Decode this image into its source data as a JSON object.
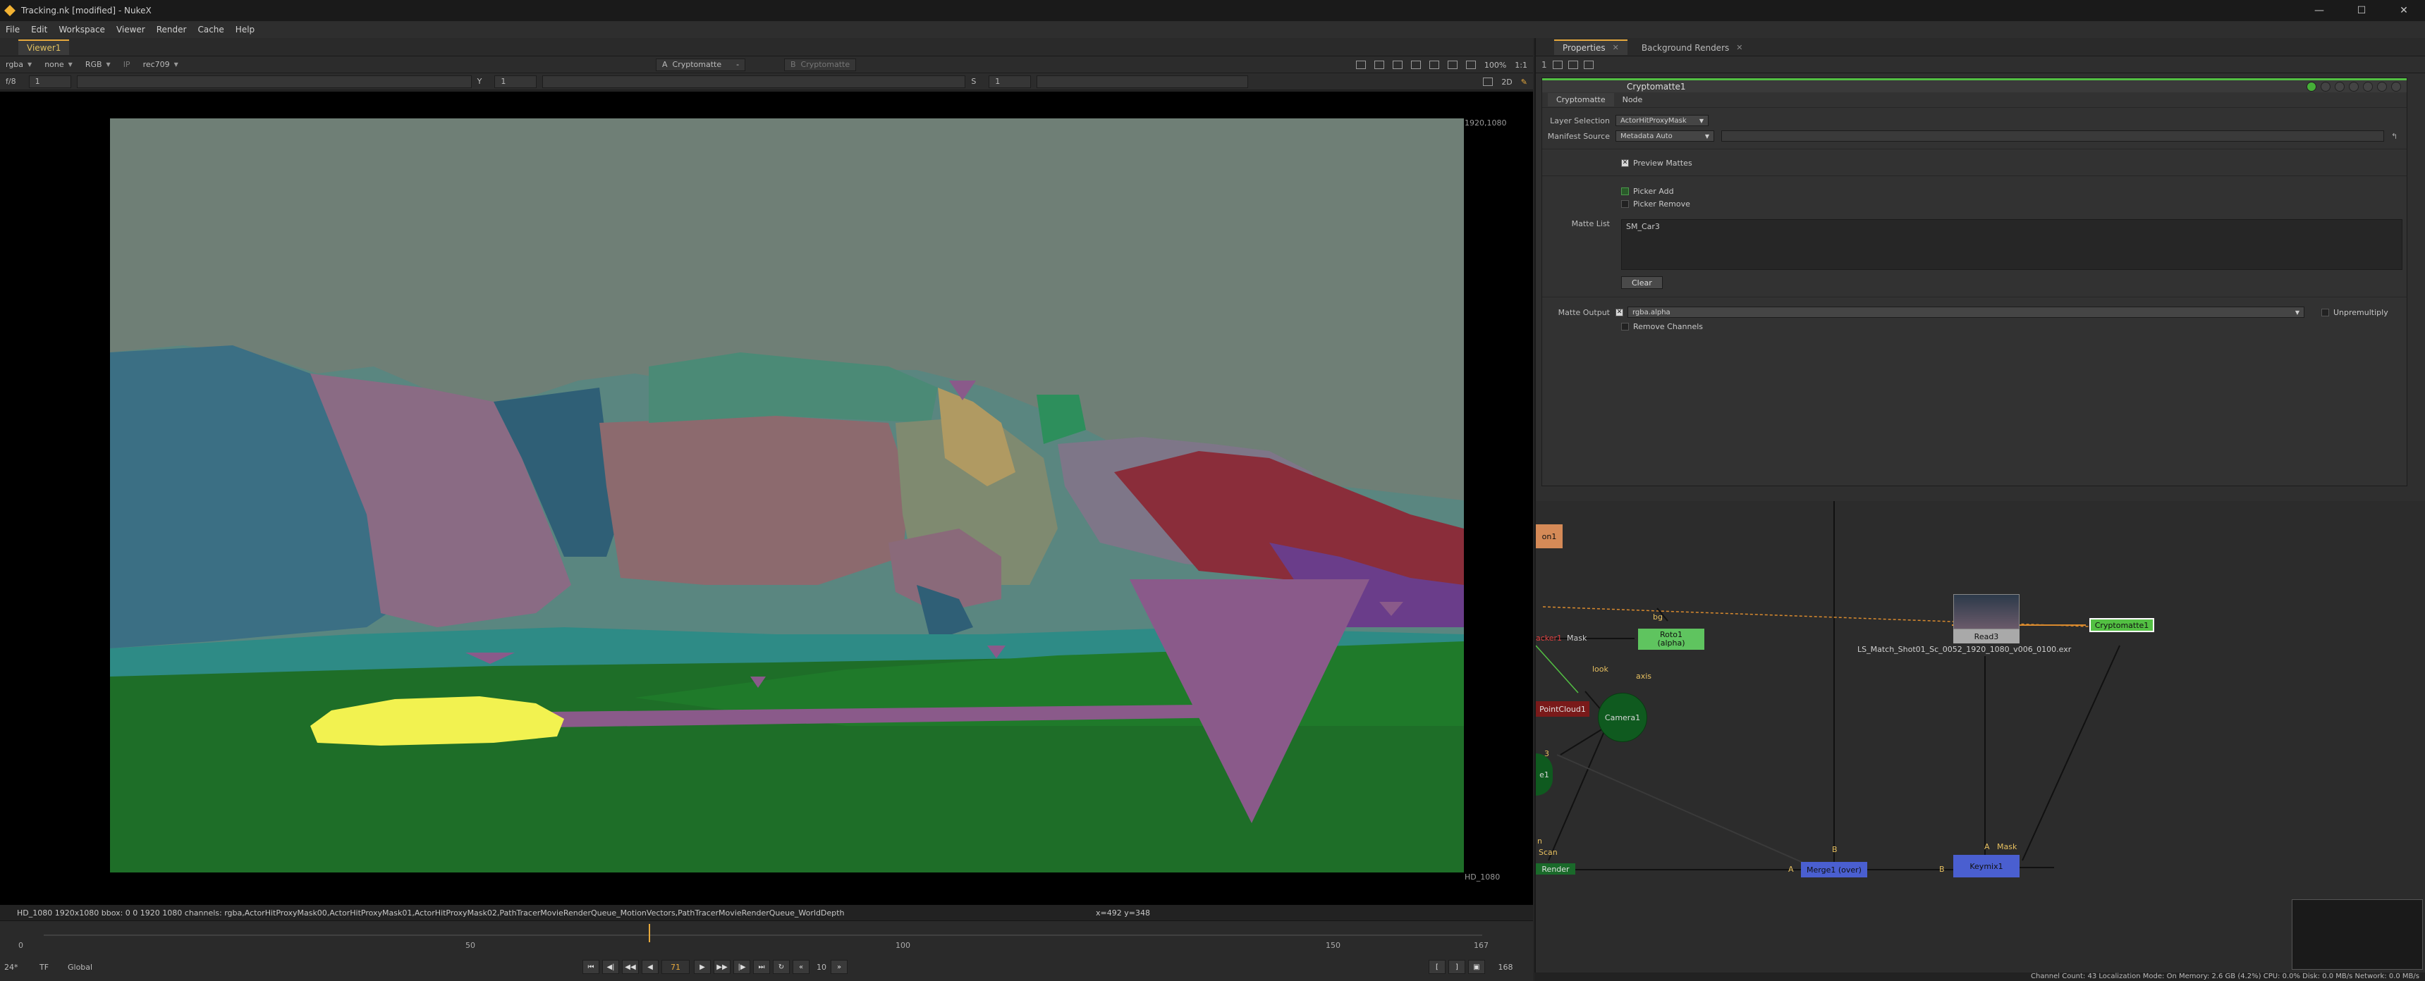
{
  "window": {
    "title": "Tracking.nk [modified] - NukeX",
    "controls": [
      "—",
      "☐",
      "✕"
    ]
  },
  "menu": [
    "File",
    "Edit",
    "Workspace",
    "Viewer",
    "Render",
    "Cache",
    "Help"
  ],
  "viewer": {
    "tab_label": "Viewer1",
    "channels": "rgba",
    "alpha": "none",
    "display": "RGB",
    "ip_label": "IP",
    "lut": "rec709",
    "frame_step": "f/8",
    "frame_val": "1",
    "y_label": "Y",
    "y_val": "1",
    "s_label": "S",
    "s_val": "1",
    "input_a_label": "A",
    "input_a": "Cryptomatte",
    "input_a_op": "-",
    "input_b_label": "B",
    "input_b": "Cryptomatte",
    "zoom": "100%",
    "ratio": "1:1",
    "view_mode": "2D",
    "format_tr": "1920,1080",
    "format_br": "HD_1080",
    "info": "HD_1080 1920x1080  bbox: 0 0 1920 1080 channels: rgba,ActorHitProxyMask00,ActorHitProxyMask01,ActorHitProxyMask02,PathTracerMovieRenderQueue_MotionVectors,PathTracerMovieRenderQueue_WorldDepth",
    "coords": "x=492 y=348"
  },
  "timeline": {
    "labels": [
      "0",
      "50",
      "100",
      "150",
      "167"
    ],
    "current": "71",
    "end": "168",
    "fps": "24*",
    "tf": "TF",
    "range": "Global",
    "step": "10"
  },
  "properties": {
    "tabs": [
      "Properties",
      "Background Renders"
    ],
    "count": "1",
    "node_name": "Cryptomatte1",
    "subtabs": [
      "Cryptomatte",
      "Node"
    ],
    "layer_selection_label": "Layer Selection",
    "layer_selection": "ActorHitProxyMask",
    "manifest_source_label": "Manifest Source",
    "manifest_source": "Metadata Auto",
    "preview_mattes": "Preview Mattes",
    "picker_add": "Picker Add",
    "picker_remove": "Picker Remove",
    "matte_list_label": "Matte List",
    "matte_list": "SM_Car3",
    "clear": "Clear",
    "matte_output_label": "Matte Output",
    "matte_output": "rgba.alpha",
    "unpremultiply": "Unpremultiply",
    "remove_channels": "Remove Channels"
  },
  "graph": {
    "nodes": {
      "crop": "on1",
      "tracker": "acker1",
      "mask": "Mask",
      "roto": "Roto1",
      "roto_sub": "(alpha)",
      "bg": "bg",
      "look": "look",
      "axis": "axis",
      "camera": "Camera1",
      "pointcloud": "PointCloud1",
      "three": "3",
      "e1": "e1",
      "read": "Read3",
      "read_file": "LS_Match_Shot01_Sc_0052_1920_1080_v006_0100.exr",
      "crypto": "Cryptomatte1",
      "merge": "Merge1 (over)",
      "keymix": "Keymix1",
      "render": "Render",
      "scan": "Scan",
      "a": "A",
      "b": "B",
      "n": "n"
    }
  },
  "statusbar": "Channel Count: 43  Localization Mode: On  Memory: 2.6 GB (4.2%)  CPU: 0.0%  Disk: 0.0 MB/s  Network: 0.0 MB/s",
  "colors": {
    "accent": "#e7a93c",
    "node_green": "#53c043",
    "camera_green": "#0f5a1f",
    "merge_blue": "#4a5fd0"
  }
}
